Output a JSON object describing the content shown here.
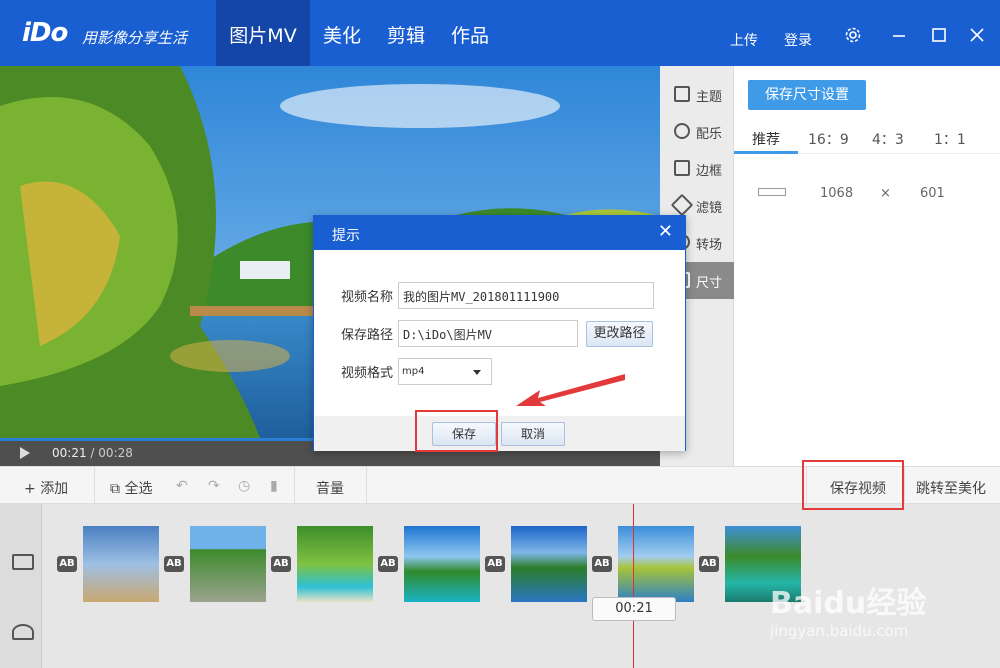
{
  "header": {
    "logo": "iDo",
    "slogan": "用影像分享生活",
    "tabs": [
      {
        "label": "图片MV",
        "active": true
      },
      {
        "label": "美化",
        "active": false
      },
      {
        "label": "剪辑",
        "active": false
      },
      {
        "label": "作品",
        "active": false
      }
    ],
    "upload_label": "上传",
    "login_label": "登录",
    "brand_color": "#1a5fd1"
  },
  "preview": {
    "current_time": "00:21",
    "separator": "/",
    "total_time": "00:28"
  },
  "sidebar": {
    "items": [
      {
        "label": "主题",
        "icon": "shirt-icon",
        "active": false
      },
      {
        "label": "配乐",
        "icon": "music-note-icon",
        "active": false
      },
      {
        "label": "边框",
        "icon": "frame-icon",
        "active": false
      },
      {
        "label": "滤镜",
        "icon": "filter-icon",
        "active": false
      },
      {
        "label": "转场",
        "icon": "transition-icon",
        "active": false
      },
      {
        "label": "尺寸",
        "icon": "size-icon",
        "active": true
      }
    ]
  },
  "size_panel": {
    "save_button": "保存尺寸设置",
    "ratios": [
      "推荐",
      "16：9",
      "4：3",
      "1：1"
    ],
    "active_ratio": "推荐",
    "width": "1068",
    "times": "×",
    "height": "601"
  },
  "dialog": {
    "title": "提示",
    "close_glyph": "✕",
    "name_label": "视频名称",
    "name_value": "我的图片MV_201801111900",
    "path_label": "保存路径",
    "path_value": "D:\\iDo\\图片MV",
    "change_path_button": "更改路径",
    "format_label": "视频格式",
    "format_value": "mp4",
    "save_button": "保存",
    "cancel_button": "取消"
  },
  "toolbar": {
    "add_label": "添加",
    "select_all_label": "全选",
    "volume_label": "音量",
    "save_video_label": "保存视频",
    "goto_beautify_label": "跳转至美化"
  },
  "timeline": {
    "playhead_time": "00:21",
    "transition_badge": "AB",
    "clip_count": 7
  },
  "watermark": {
    "brand": "Baidu经验",
    "url": "jingyan.baidu.com"
  }
}
